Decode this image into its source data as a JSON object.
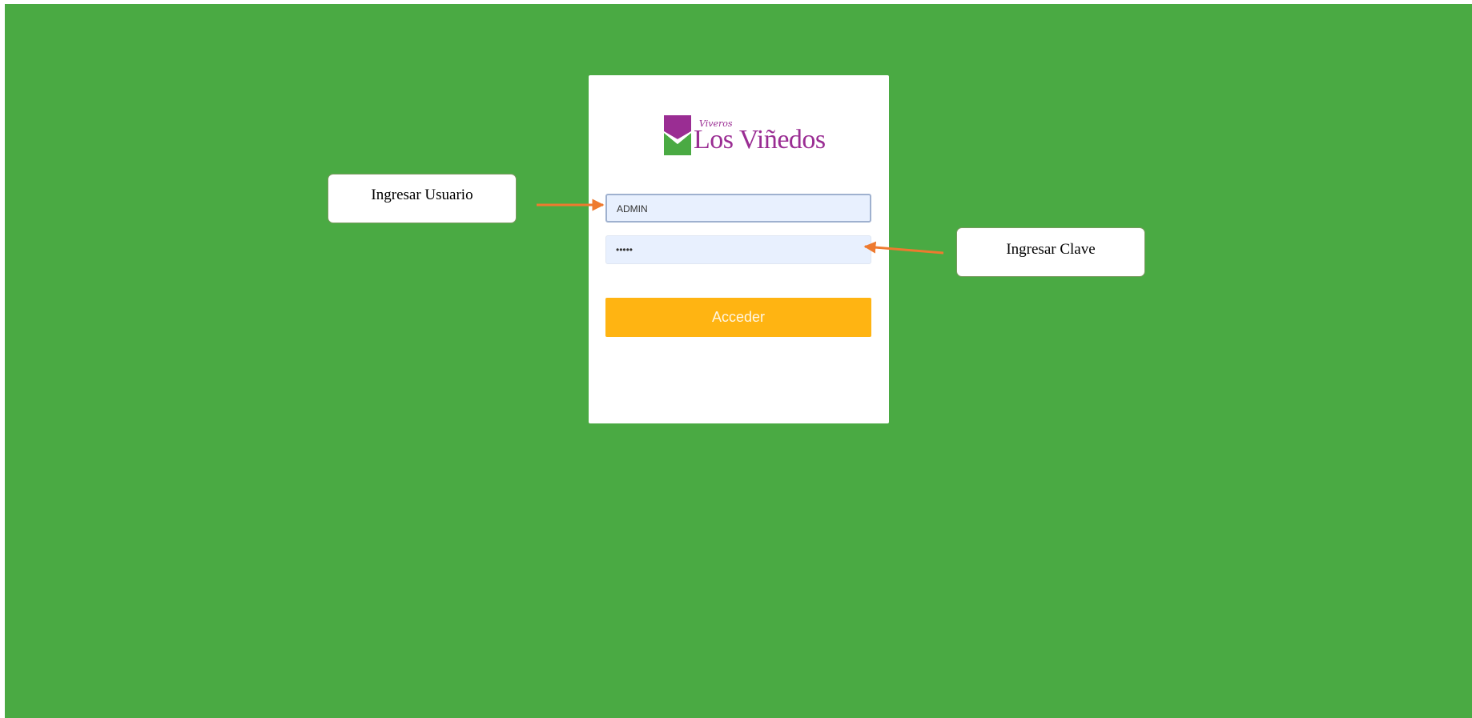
{
  "login": {
    "brand_script": "Viveros",
    "brand_name": "Los Viñedos",
    "username_value": "ADMIN",
    "password_value": "•••••",
    "submit_label": "Acceder"
  },
  "annotations": {
    "user_label": "Ingresar Usuario",
    "password_label": "Ingresar Clave"
  },
  "colors": {
    "background": "#4aaa43",
    "brand_purple": "#9a2d93",
    "brand_green": "#4aaa43",
    "button": "#ffb412",
    "arrow": "#ee7a2f"
  }
}
